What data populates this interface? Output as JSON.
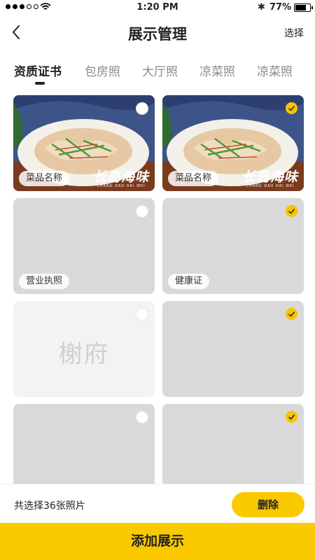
{
  "status_bar": {
    "time": "1:20 PM",
    "battery": "77%",
    "battery_level": 0.77
  },
  "header": {
    "title": "展示管理",
    "action": "选择"
  },
  "tabs": [
    {
      "label": "资质证书",
      "active": true
    },
    {
      "label": "包房照",
      "active": false
    },
    {
      "label": "大厅照",
      "active": false
    },
    {
      "label": "凉菜照",
      "active": false
    },
    {
      "label": "凉菜照",
      "active": false
    }
  ],
  "grid": [
    {
      "type": "photo",
      "label": "菜品名称",
      "brand": "长岛海味",
      "brand_sub": "CHANG DAO HAI WEI",
      "selected": false
    },
    {
      "type": "photo",
      "label": "菜品名称",
      "brand": "长岛海味",
      "brand_sub": "CHANG DAO HAI WEI",
      "selected": true
    },
    {
      "type": "placeholder",
      "label": "营业执照",
      "selected": false
    },
    {
      "type": "placeholder",
      "label": "健康证",
      "selected": true
    },
    {
      "type": "placeholder-logo",
      "logo_text": "榭府",
      "selected": false
    },
    {
      "type": "placeholder",
      "selected": true
    },
    {
      "type": "placeholder",
      "selected": false
    },
    {
      "type": "placeholder",
      "selected": true
    }
  ],
  "footer": {
    "selection_summary": "共选择36张照片",
    "delete_label": "删除",
    "add_label": "添加展示"
  },
  "colors": {
    "accent": "#fbc900",
    "check_on": "#f5c400",
    "card_gray": "#d9d9d9"
  }
}
